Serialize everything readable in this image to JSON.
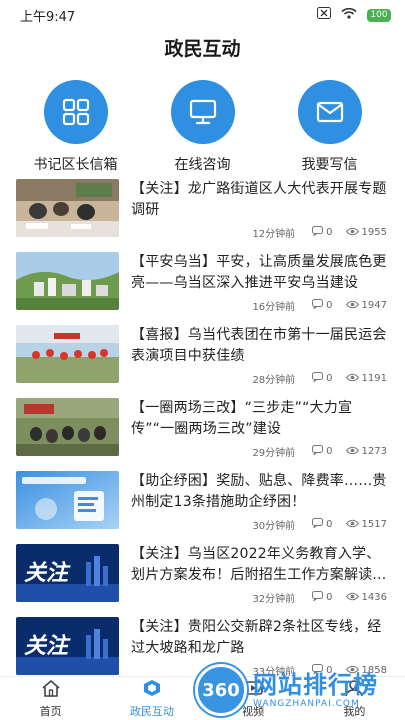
{
  "status_bar": {
    "time": "上午9:47",
    "battery": "100"
  },
  "header": {
    "title": "政民互动"
  },
  "quick_actions": [
    {
      "label": "书记区长信箱",
      "icon": "grid-icon"
    },
    {
      "label": "在线咨询",
      "icon": "monitor-icon"
    },
    {
      "label": "我要写信",
      "icon": "mail-icon"
    }
  ],
  "news": [
    {
      "title": "【关注】龙广路街道区人大代表开展专题调研",
      "time": "12分钟前",
      "comments": "0",
      "views": "1955",
      "thumb": "meeting-photo"
    },
    {
      "title": "【平安乌当】平安，让高质量发展底色更亮——乌当区深入推进平安乌当建设",
      "time": "16分钟前",
      "comments": "0",
      "views": "1947",
      "thumb": "town-photo"
    },
    {
      "title": "【喜报】乌当代表团在市第十一届民运会表演项目中获佳绩",
      "time": "28分钟前",
      "comments": "0",
      "views": "1191",
      "thumb": "performance-photo"
    },
    {
      "title": "【一圈两场三改】“三步走”“大力宣传”“一圈两场三改”建设",
      "time": "29分钟前",
      "comments": "0",
      "views": "1273",
      "thumb": "gathering-photo"
    },
    {
      "title": "【助企纾困】奖励、贴息、降费率……贵州制定13条措施助企纾困！",
      "time": "30分钟前",
      "comments": "0",
      "views": "1517",
      "thumb": "business-graphic"
    },
    {
      "title": "【关注】乌当区2022年义务教育入学、划片方案发布！后附招生工作方案解读...",
      "time": "32分钟前",
      "comments": "0",
      "views": "1436",
      "thumb": "guanzhu-graphic",
      "thumb_text": "关注"
    },
    {
      "title": "【关注】贵阳公交新辟2条社区专线，经过大坡路和龙广路",
      "time": "33分钟前",
      "comments": "0",
      "views": "1858",
      "thumb": "guanzhu-graphic",
      "thumb_text": "关注"
    }
  ],
  "bottom_nav": [
    {
      "label": "首页",
      "icon": "home-icon"
    },
    {
      "label": "政民互动",
      "icon": "interaction-icon",
      "active": true
    },
    {
      "label": "视频",
      "icon": "video-icon"
    },
    {
      "label": "我的",
      "icon": "user-icon"
    }
  ],
  "watermark": {
    "logo": "360",
    "text": "网站排行榜",
    "sub": "WANGZHANPAI.COM"
  },
  "colors": {
    "accent": "#2f8fe0",
    "battery": "#4caf50",
    "text": "#222222",
    "meta": "#666666"
  }
}
